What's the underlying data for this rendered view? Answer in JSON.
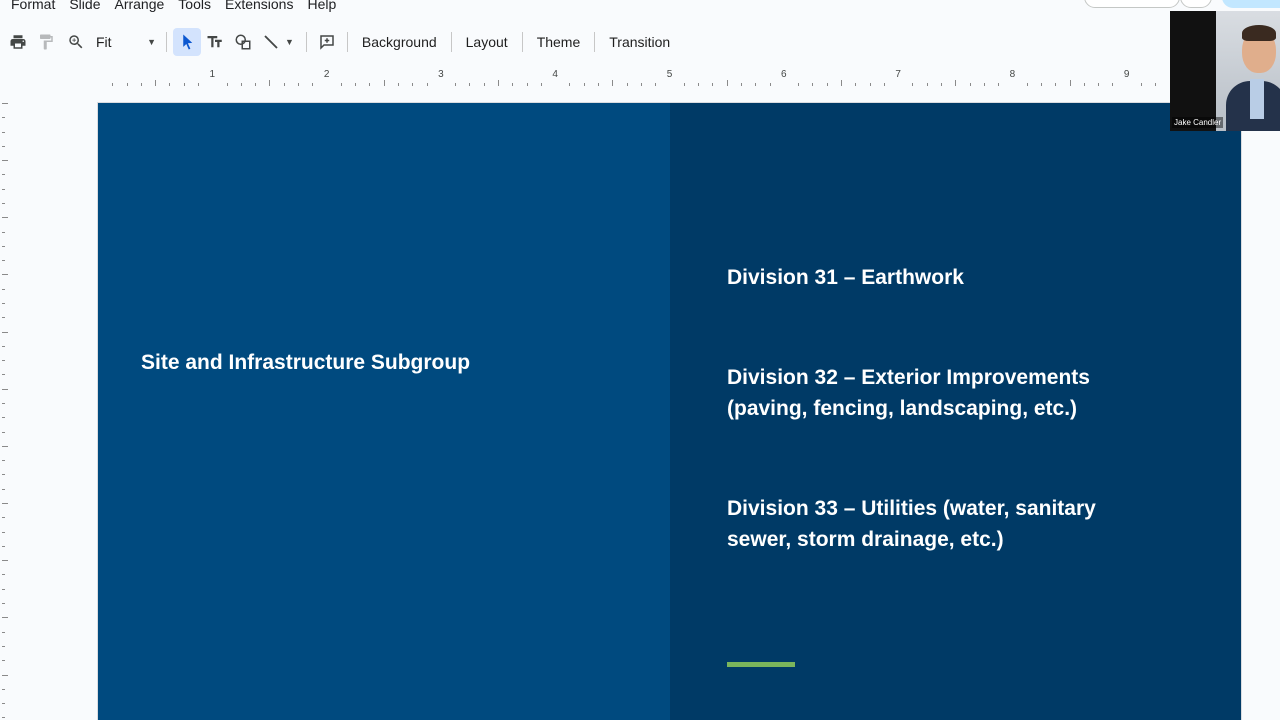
{
  "menu": [
    "Format",
    "Slide",
    "Arrange",
    "Tools",
    "Extensions",
    "Help"
  ],
  "toolbar": {
    "zoom_value": "Fit",
    "background_label": "Background",
    "layout_label": "Layout",
    "theme_label": "Theme",
    "transition_label": "Transition"
  },
  "ruler": {
    "numbers": [
      "1",
      "2",
      "3",
      "4",
      "5",
      "6",
      "7",
      "8",
      "9"
    ]
  },
  "slide": {
    "left_title": "Site and Infrastructure Subgroup",
    "divisions": [
      {
        "lines": [
          "Division 31 – Earthwork"
        ]
      },
      {
        "lines": [
          "Division 32 – Exterior Improvements",
          "(paving, fencing, landscaping, etc.)"
        ]
      },
      {
        "lines": [
          "Division 33 – Utilities (water, sanitary",
          "sewer, storm drainage, etc.)"
        ]
      }
    ],
    "colors": {
      "left_panel": "#004a7f",
      "right_panel": "#003a66",
      "accent": "#7ab55c"
    }
  },
  "video": {
    "participant_name": "Jake Candler"
  },
  "icons": [
    "print-icon",
    "paint-format-icon",
    "zoom-icon",
    "select-cursor-icon",
    "text-box-icon",
    "shape-icon",
    "line-icon",
    "new-slide-comment-icon"
  ]
}
